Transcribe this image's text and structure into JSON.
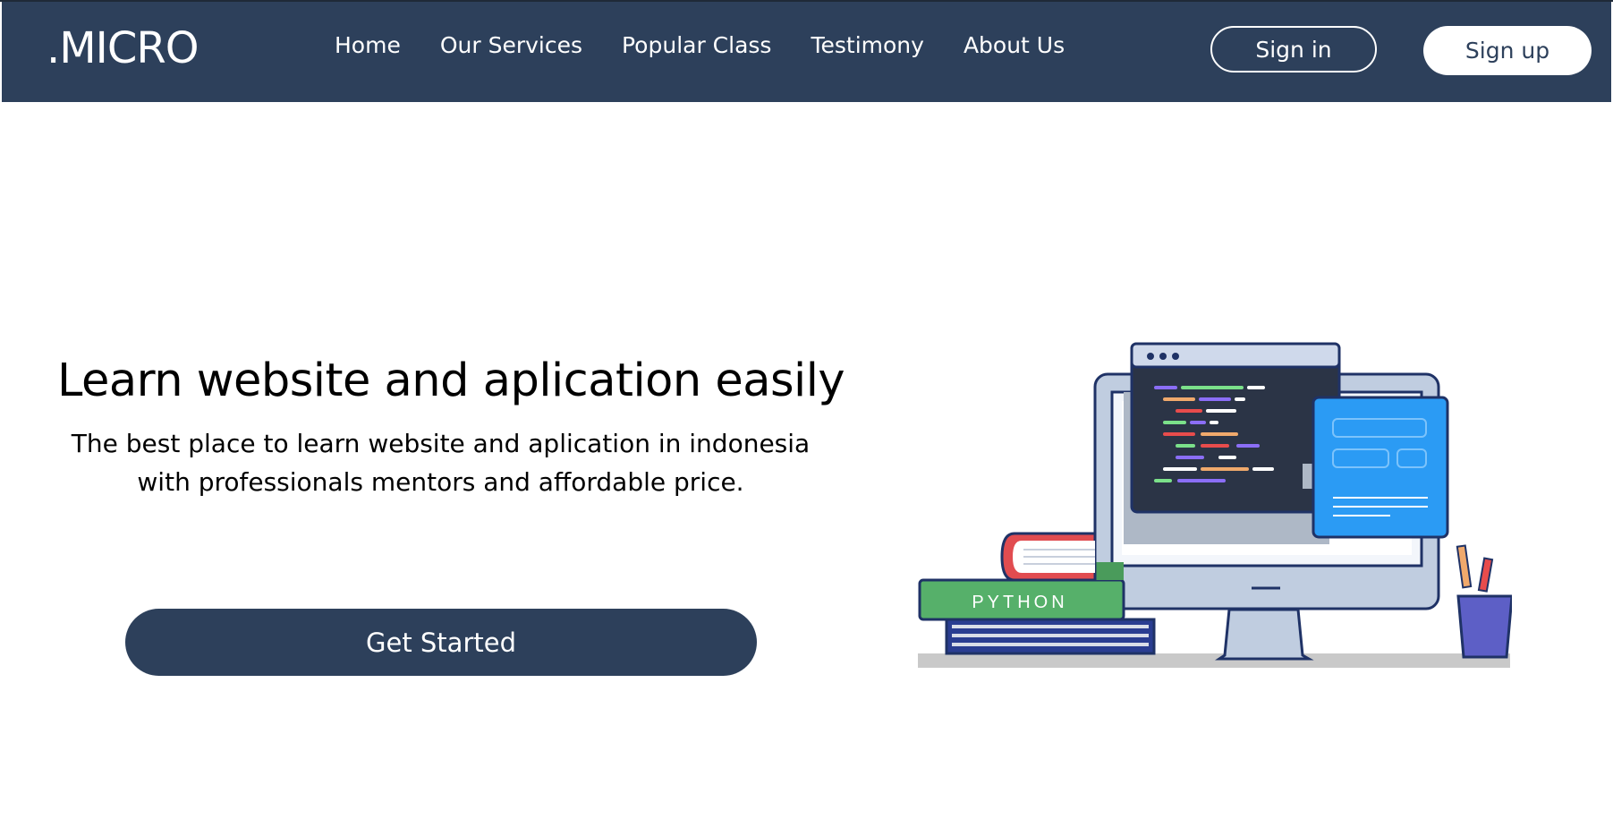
{
  "navbar": {
    "logo": ".MICRO",
    "links": [
      {
        "label": "Home"
      },
      {
        "label": "Our Services"
      },
      {
        "label": "Popular Class"
      },
      {
        "label": "Testimony"
      },
      {
        "label": "About Us"
      }
    ],
    "sign_in": "Sign in",
    "sign_up": "Sign up"
  },
  "hero": {
    "title": "Learn website and aplication easily",
    "subtitle_line1": "The best place to learn website and aplication in indonesia",
    "subtitle_line2": "with professionals mentors and affordable price.",
    "cta": "Get Started"
  },
  "illustration": {
    "book_label": "PYTHON",
    "icons": [
      "monitor-icon",
      "code-window-icon",
      "book-stack-icon",
      "pencil-cup-icon"
    ]
  },
  "colors": {
    "navbar": "#2d405b",
    "primary": "#2d405b",
    "accent_blue": "#2b9bf4",
    "book_green": "#56b06a"
  }
}
